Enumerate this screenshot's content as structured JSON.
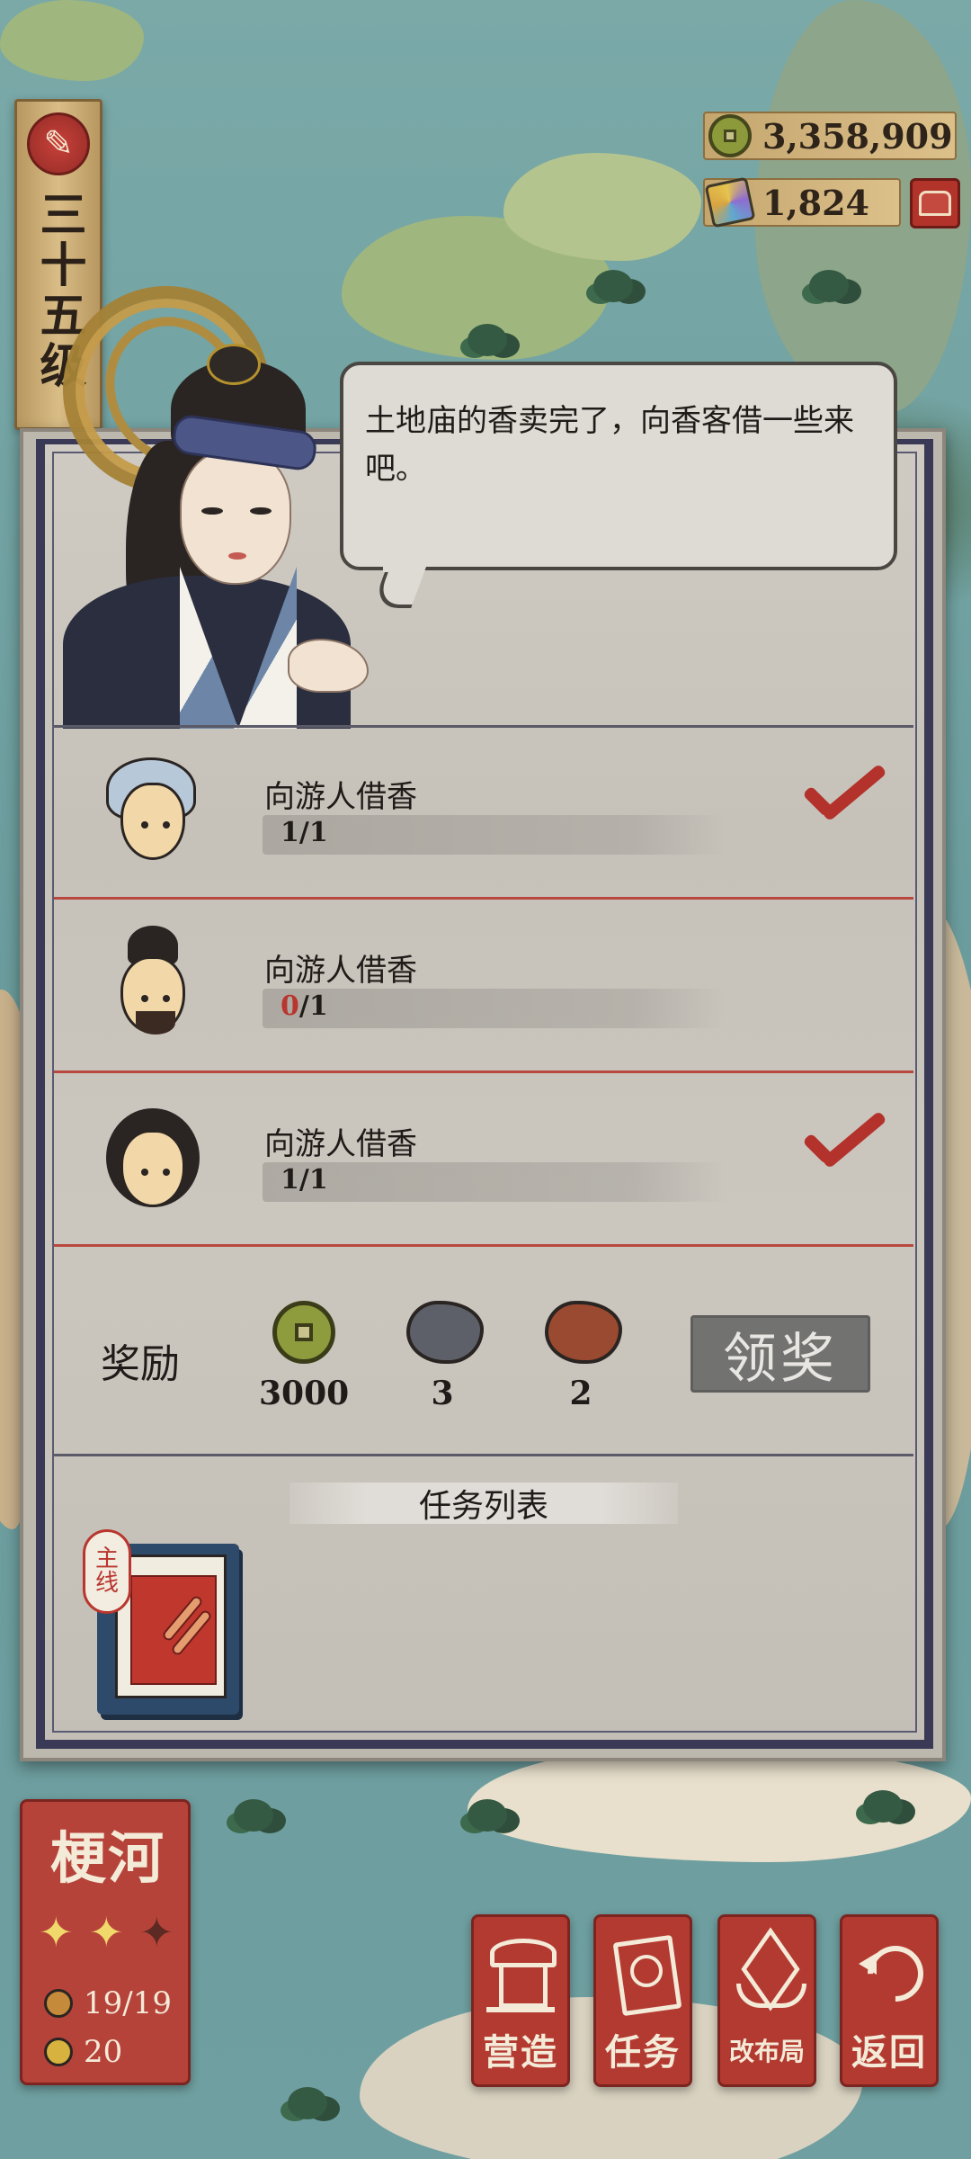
{
  "player": {
    "level_text": "三十五级"
  },
  "currencies": {
    "coins": "3,358,909",
    "gems": "1,824"
  },
  "dialog": {
    "text": "土地庙的香卖完了，向香客借一些来吧。"
  },
  "tasks": [
    {
      "title": "向游人借香",
      "current": "1",
      "sep_total": "/1",
      "completed": true,
      "avatar": "peasant-woman-headscarf-icon"
    },
    {
      "title": "向游人借香",
      "current": "0",
      "sep_total": "/1",
      "completed": false,
      "avatar": "bearded-man-icon"
    },
    {
      "title": "向游人借香",
      "current": "1",
      "sep_total": "/1",
      "completed": true,
      "avatar": "lady-with-hairpin-icon"
    }
  ],
  "reward": {
    "label": "奖励",
    "items": [
      {
        "icon": "copper-coin-icon",
        "count": "3000"
      },
      {
        "icon": "grey-stone-icon",
        "count": "3",
        "color": "#5d6068"
      },
      {
        "icon": "brown-stone-icon",
        "count": "2",
        "color": "#9a4a30"
      }
    ],
    "claim_label": "领奖"
  },
  "task_list": {
    "header": "任务列表",
    "main_badge_top": "主",
    "main_badge_bottom": "线"
  },
  "region": {
    "name": "梗河",
    "stars_lit": 2,
    "stars_total": 3,
    "population": "19/19",
    "workers": "20"
  },
  "nav": {
    "build": "营造",
    "tasks": "任务",
    "layout": "改布局",
    "back": "返回"
  },
  "colors": {
    "accent_red": "#b33a31",
    "check_red": "#b3322b",
    "panel_border": "#3a3a56"
  }
}
